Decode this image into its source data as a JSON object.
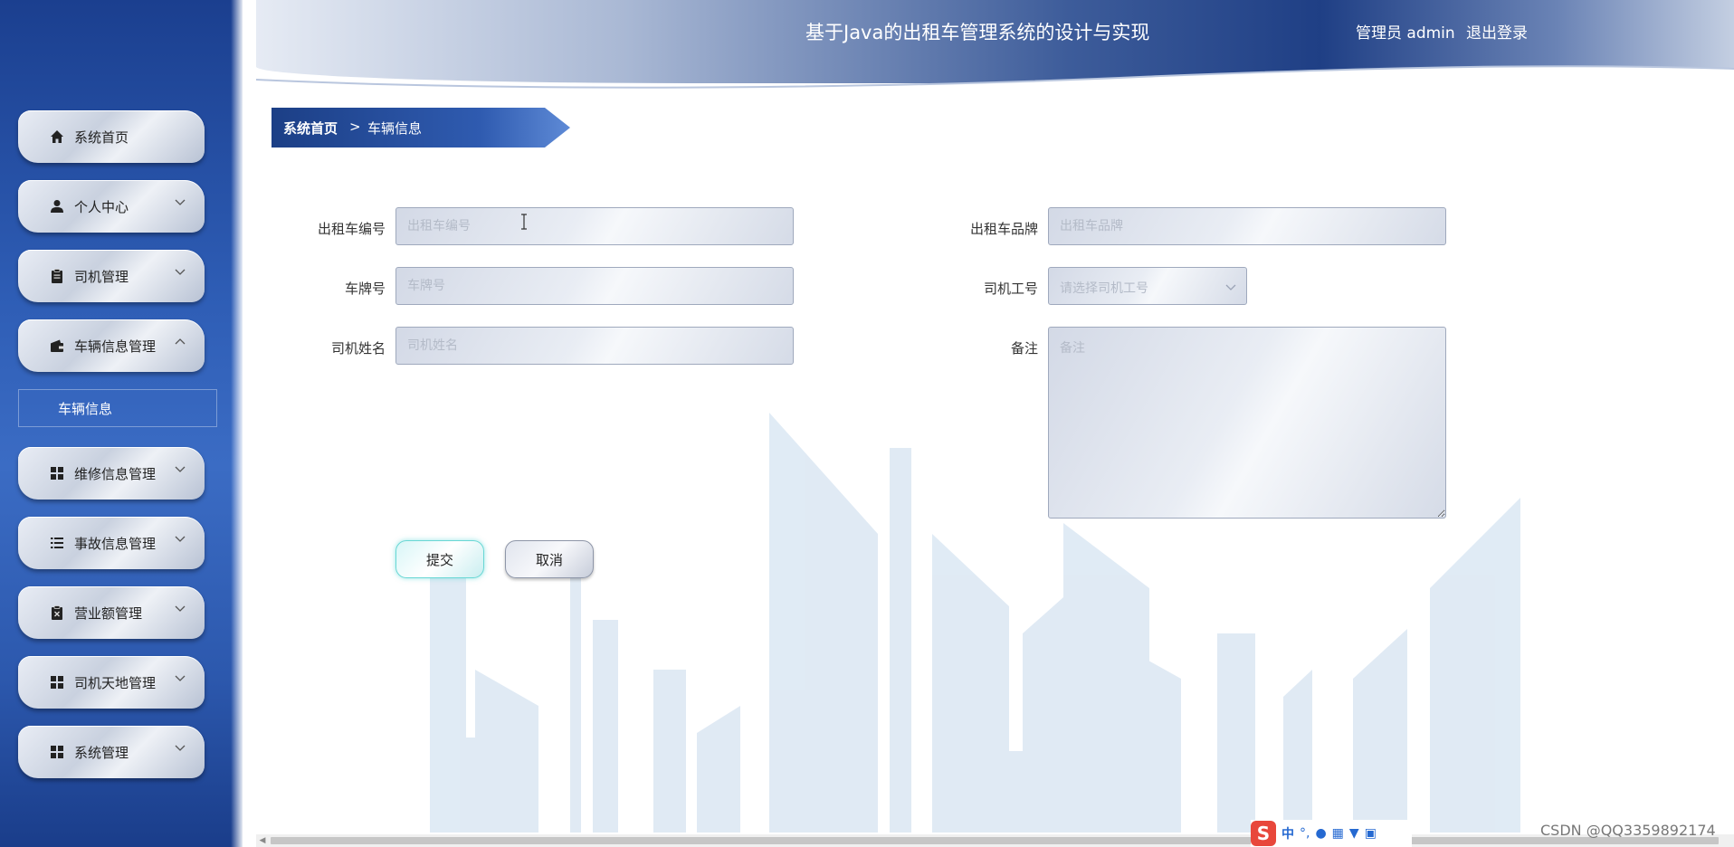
{
  "header": {
    "title": "基于Java的出租车管理系统的设计与实现",
    "user_label": "管理员 admin",
    "logout_label": "退出登录"
  },
  "sidebar": {
    "items": [
      {
        "label": "系统首页",
        "icon": "home-icon",
        "expandable": false
      },
      {
        "label": "个人中心",
        "icon": "user-icon",
        "expandable": true
      },
      {
        "label": "司机管理",
        "icon": "clipboard-icon",
        "expandable": true
      },
      {
        "label": "车辆信息管理",
        "icon": "wallet-icon",
        "expandable": true,
        "expanded": true
      },
      {
        "label": "维修信息管理",
        "icon": "grid-icon",
        "expandable": true
      },
      {
        "label": "事故信息管理",
        "icon": "list-icon",
        "expandable": true
      },
      {
        "label": "营业额管理",
        "icon": "clipboard-x-icon",
        "expandable": true
      },
      {
        "label": "司机天地管理",
        "icon": "grid-icon",
        "expandable": true
      },
      {
        "label": "系统管理",
        "icon": "grid-icon",
        "expandable": true
      }
    ],
    "submenu": {
      "label": "车辆信息"
    }
  },
  "breadcrumb": {
    "home": "系统首页",
    "separator": ">",
    "current": "车辆信息"
  },
  "form": {
    "taxi_number": {
      "label": "出租车编号",
      "placeholder": "出租车编号",
      "value": ""
    },
    "plate_number": {
      "label": "车牌号",
      "placeholder": "车牌号",
      "value": ""
    },
    "driver_name": {
      "label": "司机姓名",
      "placeholder": "司机姓名",
      "value": ""
    },
    "taxi_brand": {
      "label": "出租车品牌",
      "placeholder": "出租车品牌",
      "value": ""
    },
    "driver_id": {
      "label": "司机工号",
      "placeholder": "请选择司机工号",
      "value": ""
    },
    "remark": {
      "label": "备注",
      "placeholder": "备注",
      "value": ""
    }
  },
  "buttons": {
    "submit": "提交",
    "cancel": "取消"
  },
  "ime": {
    "logo": "S",
    "mode": "中"
  },
  "watermark": "CSDN @QQ3359892174",
  "colors": {
    "sidebar_dark": "#1b3f8f",
    "sidebar_mid": "#3b6cc4",
    "breadcrumb": "#244a97",
    "submit_border": "#69d7d4"
  }
}
